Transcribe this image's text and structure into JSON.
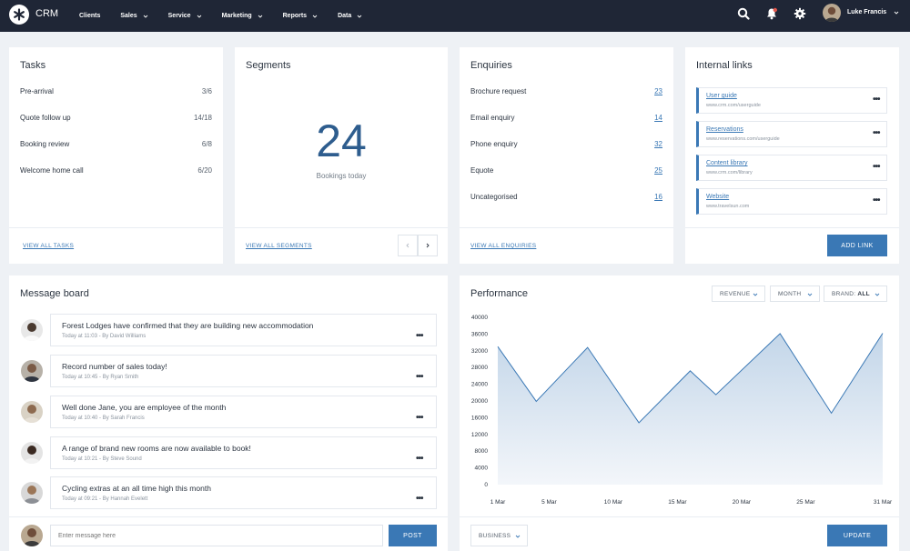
{
  "app": {
    "name": "CRM"
  },
  "nav": [
    {
      "label": "Clients",
      "dropdown": false
    },
    {
      "label": "Sales",
      "dropdown": true
    },
    {
      "label": "Service",
      "dropdown": true
    },
    {
      "label": "Marketing",
      "dropdown": true
    },
    {
      "label": "Reports",
      "dropdown": true
    },
    {
      "label": "Data",
      "dropdown": true
    }
  ],
  "user": {
    "name": "Luke Francis"
  },
  "icons": {
    "search": "search-icon",
    "notifications": "bell-icon",
    "settings": "gear-icon"
  },
  "colors": {
    "topbar": "#1f2636",
    "accent": "#3a78b5",
    "big_number": "#2e5d8e"
  },
  "tasks": {
    "title": "Tasks",
    "items": [
      {
        "label": "Pre-arrival",
        "count": "3/6"
      },
      {
        "label": "Quote follow up",
        "count": "14/18"
      },
      {
        "label": "Booking review",
        "count": "6/8"
      },
      {
        "label": "Welcome home call",
        "count": "6/20"
      }
    ],
    "footer_link": "VIEW ALL TASKS"
  },
  "segments": {
    "title": "Segments",
    "value": "24",
    "caption": "Bookings today",
    "footer_link": "VIEW ALL SEGMENTS"
  },
  "enquiries": {
    "title": "Enquiries",
    "items": [
      {
        "label": "Brochure request",
        "count": "23"
      },
      {
        "label": "Email enquiry",
        "count": "14"
      },
      {
        "label": "Phone enquiry",
        "count": "32"
      },
      {
        "label": "Equote",
        "count": "25"
      },
      {
        "label": "Uncategorised",
        "count": "16"
      }
    ],
    "footer_link": "VIEW ALL ENQUIRIES"
  },
  "internal_links": {
    "title": "Internal links",
    "items": [
      {
        "title": "User guide",
        "url": "www.crm.com/userguide"
      },
      {
        "title": "Reservations",
        "url": "www.reservations.com/userguide"
      },
      {
        "title": "Content library",
        "url": "www.crm.com/library"
      },
      {
        "title": "Website",
        "url": "www.travelsun.com"
      }
    ],
    "add_button": "ADD LINK"
  },
  "message_board": {
    "title": "Message board",
    "messages": [
      {
        "text": "Forest Lodges have confirmed that they are building new accommodation",
        "meta": "Today at 11:03 - By David Williams"
      },
      {
        "text": "Record number of sales today!",
        "meta": "Today at 10:45 - By Ryan Smith"
      },
      {
        "text": "Well done Jane, you are employee of the month",
        "meta": "Today at 10:40 - By Sarah Francis"
      },
      {
        "text": "A range of brand new rooms are now available to book!",
        "meta": "Today at 10:21 - By Steve Sound"
      },
      {
        "text": "Cycling extras at an all time high this month",
        "meta": "Today at 09:21 - By Hannah Evelett"
      }
    ],
    "input_placeholder": "Enter message here",
    "post_button": "POST"
  },
  "performance": {
    "title": "Performance",
    "filters": {
      "metric": "REVENUE",
      "period": "MONTH",
      "brand_label": "BRAND:",
      "brand_value": "ALL"
    },
    "bottom_filter": "BUSINESS",
    "update_button": "UPDATE"
  },
  "chart_data": {
    "type": "area",
    "title": "",
    "xlabel": "",
    "ylabel": "",
    "x": [
      "1 Mar",
      "4 Mar",
      "8 Mar",
      "12 Mar",
      "16 Mar",
      "19 Mar",
      "23 Mar",
      "27 Mar",
      "31 Mar"
    ],
    "x_day": [
      1,
      4,
      8,
      12,
      16,
      18,
      23,
      27,
      31
    ],
    "values": [
      33000,
      19900,
      32800,
      14800,
      27200,
      21500,
      36100,
      17100,
      36200
    ],
    "x_ticks": [
      "1 Mar",
      "5 Mar",
      "10 Mar",
      "15 Mar",
      "20 Mar",
      "25 Mar",
      "31 Mar"
    ],
    "x_tick_days": [
      1,
      5,
      10,
      15,
      20,
      25,
      31
    ],
    "y_ticks": [
      "40000",
      "36000",
      "32000",
      "28000",
      "24000",
      "20000",
      "16000",
      "12000",
      "8000",
      "4000",
      "0"
    ],
    "ylim": [
      0,
      40000
    ],
    "grid": false,
    "legend": "none"
  }
}
